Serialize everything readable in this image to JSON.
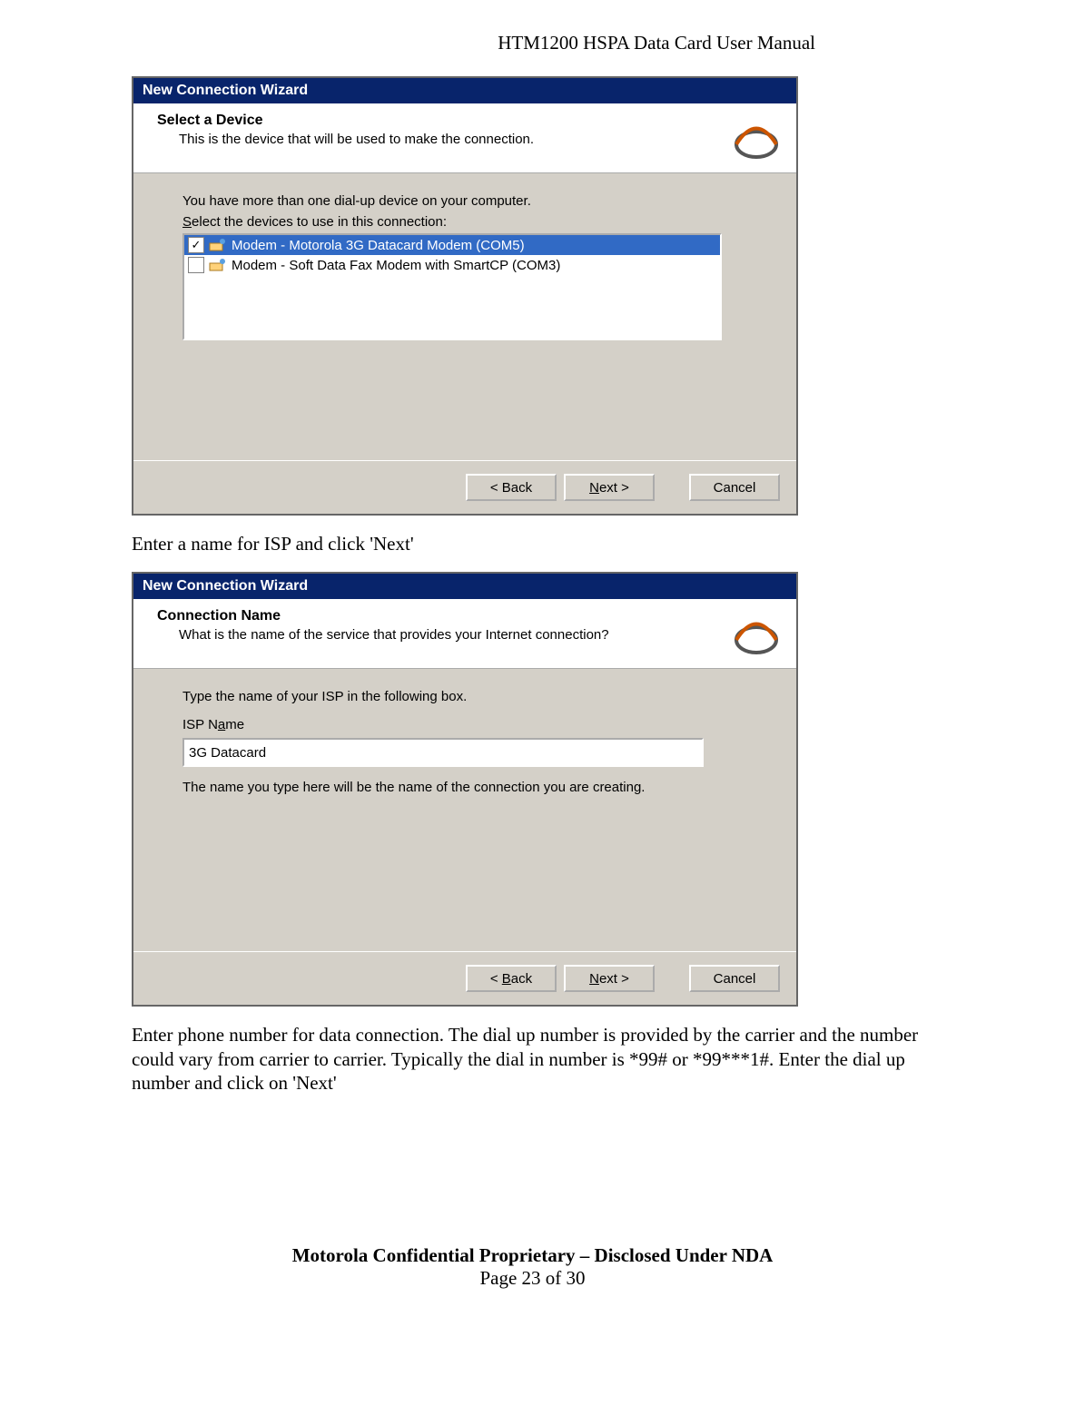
{
  "header": "HTM1200 HSPA Data Card User Manual",
  "wizard1": {
    "window_title": "New Connection Wizard",
    "header_title": "Select a Device",
    "header_sub": "This is the device that will be used to make the connection.",
    "body_line1": "You have more than one dial-up device on your computer.",
    "body_line2": "Select the devices to use in this connection:",
    "items": [
      {
        "checked": true,
        "selected": true,
        "label": "Modem - Motorola 3G Datacard Modem (COM5)"
      },
      {
        "checked": false,
        "selected": false,
        "label": "Modem - Soft Data Fax Modem with SmartCP (COM3)"
      }
    ],
    "back": "< Back",
    "next": "Next >",
    "cancel": "Cancel"
  },
  "para1": "Enter a name for ISP and click 'Next'",
  "wizard2": {
    "window_title": "New Connection Wizard",
    "header_title": "Connection Name",
    "header_sub": "What is the name of the service that provides your Internet connection?",
    "body_line1": "Type the name of your ISP in the following box.",
    "isp_label": "ISP Name",
    "isp_value": "3G Datacard",
    "body_line2": "The name you type here will be the name of the connection you are creating.",
    "back": "< Back",
    "next": "Next >",
    "cancel": "Cancel"
  },
  "para2": "Enter phone number for data connection.  The dial up number is provided by the carrier and the number could vary from carrier to carrier. Typically the dial in number is *99# or *99***1#.  Enter the dial up number and click on 'Next'",
  "footer_line1": "Motorola Confidential Proprietary – Disclosed Under NDA",
  "footer_line2": "Page 23 of 30"
}
